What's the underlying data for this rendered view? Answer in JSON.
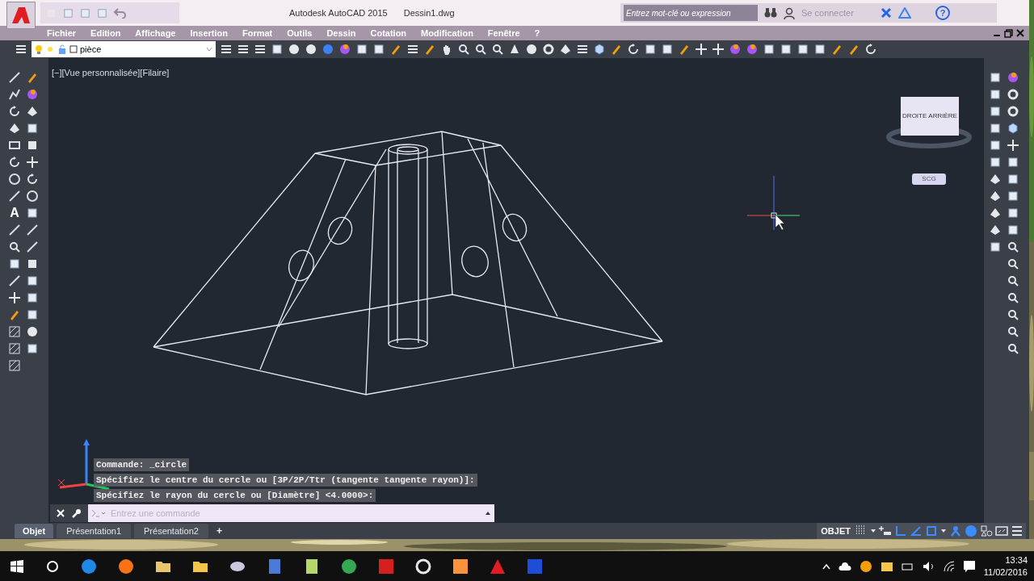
{
  "title_bar": {
    "app_name": "Autodesk AutoCAD 2015",
    "document": "Dessin1.dwg",
    "search": {
      "placeholder": "Entrez mot-clé ou expression"
    },
    "sign_in": "Se connecter",
    "help": "?"
  },
  "menu": [
    {
      "label": "Fichier"
    },
    {
      "label": "Edition"
    },
    {
      "label": "Affichage"
    },
    {
      "label": "Insertion"
    },
    {
      "label": "Format"
    },
    {
      "label": "Outils"
    },
    {
      "label": "Dessin"
    },
    {
      "label": "Cotation"
    },
    {
      "label": "Modification"
    },
    {
      "label": "Fenêtre"
    },
    {
      "label": "?"
    }
  ],
  "layer_dropdown": {
    "value": "pièce"
  },
  "text_tool": "A",
  "viewport_label": "[−][Vue personnalisée][Filaire]",
  "viewcube": {
    "faces": [
      "DROITE",
      "ARRIÈRE"
    ],
    "ucs_button": "SCG"
  },
  "command_history": [
    "Commande: _circle",
    "Spécifiez le centre du cercle ou [3P/2P/Ttr (tangente tangente rayon)]:",
    "Spécifiez le rayon du cercle ou [Diamètre] <4.0000>:"
  ],
  "command_line": {
    "placeholder": "Entrez une commande"
  },
  "layout_tabs": [
    {
      "label": "Objet",
      "selected": true
    },
    {
      "label": "Présentation1",
      "selected": false
    },
    {
      "label": "Présentation2",
      "selected": false
    }
  ],
  "add_tab": "+",
  "status_bar": {
    "space": "OBJET",
    "toggles": [
      {
        "kind": "grid",
        "on": false
      },
      {
        "kind": "infer",
        "on": false
      },
      {
        "kind": "ortho",
        "on": true
      },
      {
        "kind": "polar",
        "on": true
      },
      {
        "kind": "osnap",
        "on": true
      },
      {
        "kind": "ducs",
        "on": true
      },
      {
        "kind": "transparency",
        "on": true
      },
      {
        "kind": "isolate",
        "on": false
      },
      {
        "kind": "fullscreen",
        "on": false
      },
      {
        "kind": "customize",
        "on": false
      }
    ]
  },
  "taskbar": {
    "time": "13:34",
    "date": "11/02/2016"
  }
}
